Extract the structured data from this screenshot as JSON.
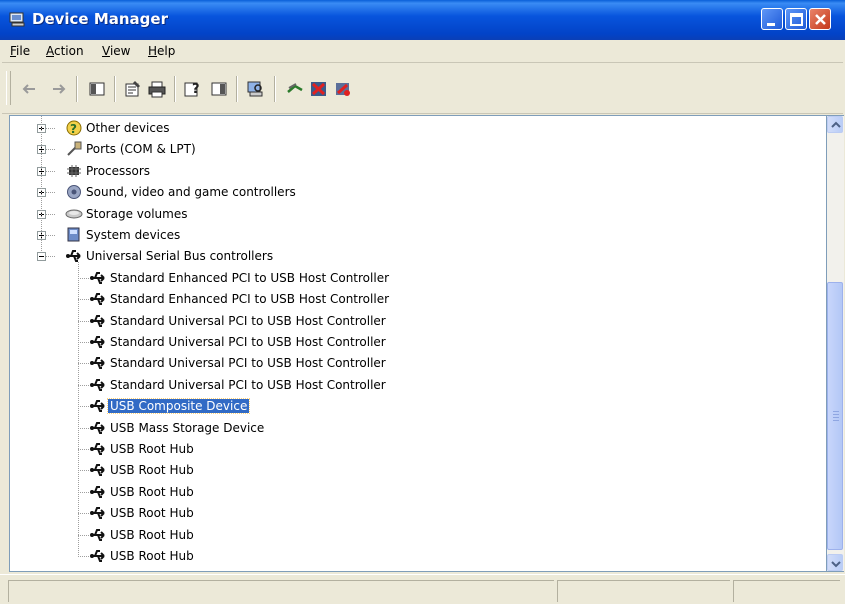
{
  "window": {
    "title": "Device Manager",
    "title_icon": "computer-monitor-icon",
    "buttons": [
      "minimize",
      "maximize",
      "close"
    ]
  },
  "menu": [
    {
      "label": "File",
      "mnemonic": "F",
      "rest": "ile"
    },
    {
      "label": "Action",
      "mnemonic": "A",
      "rest": "ction"
    },
    {
      "label": "View",
      "mnemonic": "V",
      "rest": "iew"
    },
    {
      "label": "Help",
      "mnemonic": "H",
      "rest": "elp"
    }
  ],
  "toolbar": {
    "icons": [
      "back-arrow-icon",
      "forward-arrow-icon",
      "show-hide-console-tree-icon",
      "properties-icon",
      "print-icon",
      "help-icon",
      "show-hide-action-pane-icon",
      "scan-hardware-changes-icon",
      "update-driver-icon",
      "uninstall-icon",
      "disable-device-icon"
    ]
  },
  "tree": {
    "categories": [
      {
        "label": "Other devices",
        "expanded": false,
        "icon": "other-devices-question-icon"
      },
      {
        "label": "Ports (COM & LPT)",
        "expanded": false,
        "icon": "port-connector-icon"
      },
      {
        "label": "Processors",
        "expanded": false,
        "icon": "processor-chip-icon"
      },
      {
        "label": "Sound, video and game controllers",
        "expanded": false,
        "icon": "speaker-icon"
      },
      {
        "label": "Storage volumes",
        "expanded": false,
        "icon": "storage-volume-icon"
      },
      {
        "label": "System devices",
        "expanded": false,
        "icon": "system-device-icon"
      },
      {
        "label": "Universal Serial Bus controllers",
        "expanded": true,
        "icon": "usb-icon"
      }
    ],
    "usb_children": [
      {
        "label": "Standard Enhanced PCI to USB Host Controller",
        "selected": false
      },
      {
        "label": "Standard Enhanced PCI to USB Host Controller",
        "selected": false
      },
      {
        "label": "Standard Universal PCI to USB Host Controller",
        "selected": false
      },
      {
        "label": "Standard Universal PCI to USB Host Controller",
        "selected": false
      },
      {
        "label": "Standard Universal PCI to USB Host Controller",
        "selected": false
      },
      {
        "label": "Standard Universal PCI to USB Host Controller",
        "selected": false
      },
      {
        "label": "USB Composite Device",
        "selected": true
      },
      {
        "label": "USB Mass Storage Device",
        "selected": false
      },
      {
        "label": "USB Root Hub",
        "selected": false
      },
      {
        "label": "USB Root Hub",
        "selected": false
      },
      {
        "label": "USB Root Hub",
        "selected": false
      },
      {
        "label": "USB Root Hub",
        "selected": false
      },
      {
        "label": "USB Root Hub",
        "selected": false
      },
      {
        "label": "USB Root Hub",
        "selected": false
      }
    ]
  },
  "colors": {
    "titlebar": "#0855dd",
    "selection": "#316ac5",
    "face": "#ece9d8"
  }
}
